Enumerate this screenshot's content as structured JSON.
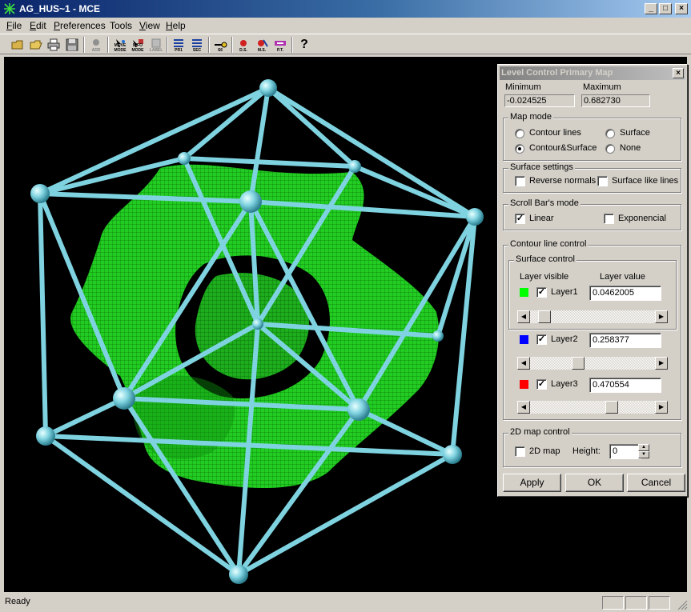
{
  "window": {
    "title": "AG_HUS~1 - MCE",
    "minimize_glyph": "_",
    "maximize_glyph": "□",
    "close_glyph": "×"
  },
  "menu": [
    {
      "label": "File",
      "accel": "F",
      "rest": "ile"
    },
    {
      "label": "Edit",
      "accel": "E",
      "rest": "dit"
    },
    {
      "label": "Preferences",
      "accel": "P",
      "rest": "references"
    },
    {
      "label": "Tools",
      "accel": "",
      "rest": "Tools"
    },
    {
      "label": "View",
      "accel": "V",
      "rest": "iew"
    },
    {
      "label": "Help",
      "accel": "H",
      "rest": "elp"
    }
  ],
  "toolbar": {
    "icons": [
      "open-icon",
      "open-folder-icon",
      "print-icon",
      "save-icon",
      "add-icon",
      "move-mode-icon",
      "info-mode-icon",
      "label-icon",
      "pr1-icon",
      "sec-icon",
      "s6-icon",
      "ds-icon",
      "ms-icon",
      "pt-icon",
      "help-icon"
    ],
    "labels": {
      "add": "ADD",
      "move": "MOVE MODE",
      "info": "INFO MODE",
      "label": "LABEL",
      "pr1": "PR1",
      "sec": "SEC",
      "s6": "S6",
      "ds": "D.S.",
      "ms": "M.S.",
      "pt": "P.T."
    },
    "help_glyph": "?"
  },
  "status": {
    "text": "Ready"
  },
  "dialog": {
    "title": "Level Control Primary Map",
    "close_glyph": "×",
    "minimum_label": "Minimum",
    "maximum_label": "Maximum",
    "minimum_value": "-0.024525",
    "maximum_value": "0.682730",
    "map_mode": {
      "title": "Map mode",
      "options": [
        "Contour lines",
        "Surface",
        "Contour&Surface",
        "None"
      ],
      "selected": "Contour&Surface"
    },
    "surface_settings": {
      "title": "Surface settings",
      "reverse_normals": "Reverse normals",
      "surface_like_lines": "Surface like lines"
    },
    "scroll_bar_mode": {
      "title": "Scroll Bar's mode",
      "linear": "Linear",
      "linear_checked": true,
      "exponencial": "Exponencial"
    },
    "contour_line_control": {
      "title": "Contour line control",
      "surface_control_title": "Surface control",
      "layer_visible_header": "Layer visible",
      "layer_value_header": "Layer value",
      "layers": [
        {
          "name": "Layer1",
          "value": "0.0462005",
          "color": "#00ff00",
          "checked": true,
          "slider_fraction": 0.07
        },
        {
          "name": "Layer2",
          "value": "0.258377",
          "color": "#0000ff",
          "checked": true,
          "slider_fraction": 0.37
        },
        {
          "name": "Layer3",
          "value": "0.470554",
          "color": "#ff0000",
          "checked": true,
          "slider_fraction": 0.67
        }
      ]
    },
    "map2d": {
      "title": "2D map control",
      "checkbox_label": "2D map",
      "height_label": "Height:",
      "height_value": "0"
    },
    "buttons": {
      "apply": "Apply",
      "ok": "OK",
      "cancel": "Cancel"
    }
  },
  "colors": {
    "frame": "#7fd3e0",
    "surface": "#22cc22",
    "viewport_bg": "#000000"
  }
}
